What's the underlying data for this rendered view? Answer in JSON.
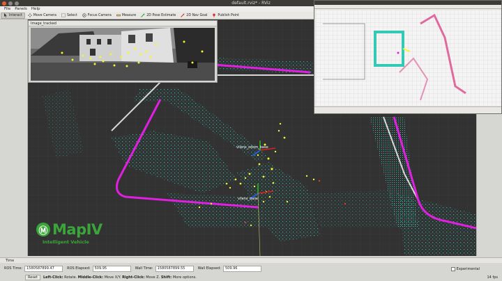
{
  "window": {
    "title": "default.rviz* - RViz"
  },
  "menu": [
    "File",
    "Panels",
    "Help"
  ],
  "toolbar": [
    {
      "label": "Interact",
      "icon": "interact-icon",
      "active": true
    },
    {
      "label": "Move Camera",
      "icon": "move-camera-icon",
      "active": false
    },
    {
      "label": "Select",
      "icon": "select-icon",
      "active": false
    },
    {
      "label": "Focus Camera",
      "icon": "focus-camera-icon",
      "active": false
    },
    {
      "label": "Measure",
      "icon": "measure-icon",
      "active": false
    },
    {
      "label": "2D Pose Estimate",
      "icon": "pose-estimate-icon",
      "active": false
    },
    {
      "label": "2D Nav Goal",
      "icon": "nav-goal-icon",
      "active": false
    },
    {
      "label": "Publish Point",
      "icon": "publish-point-icon",
      "active": false
    }
  ],
  "image_panel": {
    "title": "Image_tracked"
  },
  "frames": {
    "top": "vilens_odom_base",
    "bottom": "vilens_base"
  },
  "logo": {
    "name": "MapIV",
    "tagline": "Intelligent Vehicle"
  },
  "time_panel": {
    "title": "Time",
    "ros_time_label": "ROS Time:",
    "ros_time": "1580587899.47",
    "ros_elapsed_label": "ROS Elapsed:",
    "ros_elapsed": "509.95",
    "wall_time_label": "Wall Time:",
    "wall_time": "1580587899.55",
    "wall_elapsed_label": "Wall Elapsed:",
    "wall_elapsed": "509.96",
    "experimental_label": "Experimental"
  },
  "status": {
    "reset_label": "Reset",
    "hint_bold1": "Left-Click:",
    "hint1": " Rotate. ",
    "hint_bold2": "Middle-Click:",
    "hint2": " Move X/Y. ",
    "hint_bold3": "Right-Click:",
    "hint3": " Move Z. ",
    "hint_bold4": "Shift:",
    "hint4": " More options.",
    "fps": "14 fps"
  },
  "colors": {
    "path": "#e020e0",
    "cloud": "#33c9b5",
    "features": "#f4f432",
    "road": "#d8d8d8",
    "brand": "#3aa639"
  }
}
